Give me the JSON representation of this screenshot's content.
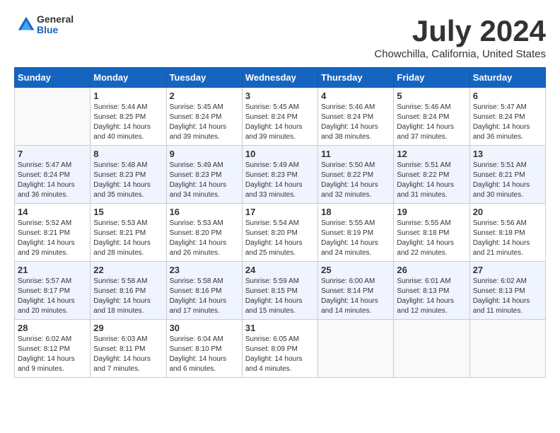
{
  "header": {
    "logo_general": "General",
    "logo_blue": "Blue",
    "month_title": "July 2024",
    "location": "Chowchilla, California, United States"
  },
  "days_of_week": [
    "Sunday",
    "Monday",
    "Tuesday",
    "Wednesday",
    "Thursday",
    "Friday",
    "Saturday"
  ],
  "weeks": [
    [
      {
        "day": "",
        "info": ""
      },
      {
        "day": "1",
        "info": "Sunrise: 5:44 AM\nSunset: 8:25 PM\nDaylight: 14 hours\nand 40 minutes."
      },
      {
        "day": "2",
        "info": "Sunrise: 5:45 AM\nSunset: 8:24 PM\nDaylight: 14 hours\nand 39 minutes."
      },
      {
        "day": "3",
        "info": "Sunrise: 5:45 AM\nSunset: 8:24 PM\nDaylight: 14 hours\nand 39 minutes."
      },
      {
        "day": "4",
        "info": "Sunrise: 5:46 AM\nSunset: 8:24 PM\nDaylight: 14 hours\nand 38 minutes."
      },
      {
        "day": "5",
        "info": "Sunrise: 5:46 AM\nSunset: 8:24 PM\nDaylight: 14 hours\nand 37 minutes."
      },
      {
        "day": "6",
        "info": "Sunrise: 5:47 AM\nSunset: 8:24 PM\nDaylight: 14 hours\nand 36 minutes."
      }
    ],
    [
      {
        "day": "7",
        "info": "Sunrise: 5:47 AM\nSunset: 8:24 PM\nDaylight: 14 hours\nand 36 minutes."
      },
      {
        "day": "8",
        "info": "Sunrise: 5:48 AM\nSunset: 8:23 PM\nDaylight: 14 hours\nand 35 minutes."
      },
      {
        "day": "9",
        "info": "Sunrise: 5:49 AM\nSunset: 8:23 PM\nDaylight: 14 hours\nand 34 minutes."
      },
      {
        "day": "10",
        "info": "Sunrise: 5:49 AM\nSunset: 8:23 PM\nDaylight: 14 hours\nand 33 minutes."
      },
      {
        "day": "11",
        "info": "Sunrise: 5:50 AM\nSunset: 8:22 PM\nDaylight: 14 hours\nand 32 minutes."
      },
      {
        "day": "12",
        "info": "Sunrise: 5:51 AM\nSunset: 8:22 PM\nDaylight: 14 hours\nand 31 minutes."
      },
      {
        "day": "13",
        "info": "Sunrise: 5:51 AM\nSunset: 8:21 PM\nDaylight: 14 hours\nand 30 minutes."
      }
    ],
    [
      {
        "day": "14",
        "info": "Sunrise: 5:52 AM\nSunset: 8:21 PM\nDaylight: 14 hours\nand 29 minutes."
      },
      {
        "day": "15",
        "info": "Sunrise: 5:53 AM\nSunset: 8:21 PM\nDaylight: 14 hours\nand 28 minutes."
      },
      {
        "day": "16",
        "info": "Sunrise: 5:53 AM\nSunset: 8:20 PM\nDaylight: 14 hours\nand 26 minutes."
      },
      {
        "day": "17",
        "info": "Sunrise: 5:54 AM\nSunset: 8:20 PM\nDaylight: 14 hours\nand 25 minutes."
      },
      {
        "day": "18",
        "info": "Sunrise: 5:55 AM\nSunset: 8:19 PM\nDaylight: 14 hours\nand 24 minutes."
      },
      {
        "day": "19",
        "info": "Sunrise: 5:55 AM\nSunset: 8:18 PM\nDaylight: 14 hours\nand 22 minutes."
      },
      {
        "day": "20",
        "info": "Sunrise: 5:56 AM\nSunset: 8:18 PM\nDaylight: 14 hours\nand 21 minutes."
      }
    ],
    [
      {
        "day": "21",
        "info": "Sunrise: 5:57 AM\nSunset: 8:17 PM\nDaylight: 14 hours\nand 20 minutes."
      },
      {
        "day": "22",
        "info": "Sunrise: 5:58 AM\nSunset: 8:16 PM\nDaylight: 14 hours\nand 18 minutes."
      },
      {
        "day": "23",
        "info": "Sunrise: 5:58 AM\nSunset: 8:16 PM\nDaylight: 14 hours\nand 17 minutes."
      },
      {
        "day": "24",
        "info": "Sunrise: 5:59 AM\nSunset: 8:15 PM\nDaylight: 14 hours\nand 15 minutes."
      },
      {
        "day": "25",
        "info": "Sunrise: 6:00 AM\nSunset: 8:14 PM\nDaylight: 14 hours\nand 14 minutes."
      },
      {
        "day": "26",
        "info": "Sunrise: 6:01 AM\nSunset: 8:13 PM\nDaylight: 14 hours\nand 12 minutes."
      },
      {
        "day": "27",
        "info": "Sunrise: 6:02 AM\nSunset: 8:13 PM\nDaylight: 14 hours\nand 11 minutes."
      }
    ],
    [
      {
        "day": "28",
        "info": "Sunrise: 6:02 AM\nSunset: 8:12 PM\nDaylight: 14 hours\nand 9 minutes."
      },
      {
        "day": "29",
        "info": "Sunrise: 6:03 AM\nSunset: 8:11 PM\nDaylight: 14 hours\nand 7 minutes."
      },
      {
        "day": "30",
        "info": "Sunrise: 6:04 AM\nSunset: 8:10 PM\nDaylight: 14 hours\nand 6 minutes."
      },
      {
        "day": "31",
        "info": "Sunrise: 6:05 AM\nSunset: 8:09 PM\nDaylight: 14 hours\nand 4 minutes."
      },
      {
        "day": "",
        "info": ""
      },
      {
        "day": "",
        "info": ""
      },
      {
        "day": "",
        "info": ""
      }
    ]
  ]
}
